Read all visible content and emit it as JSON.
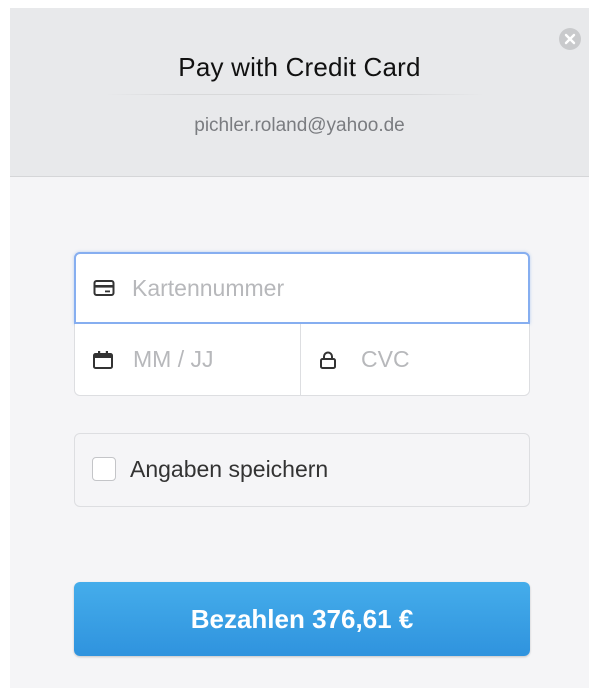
{
  "header": {
    "title": "Pay with Credit Card",
    "email": "pichler.roland@yahoo.de"
  },
  "form": {
    "card_number": {
      "placeholder": "Kartennummer",
      "value": "",
      "icon": "credit-card-icon"
    },
    "expiry": {
      "placeholder": "MM / JJ",
      "value": "",
      "icon": "calendar-icon"
    },
    "cvc": {
      "placeholder": "CVC",
      "value": "",
      "icon": "lock-icon"
    },
    "remember": {
      "label": "Angaben speichern",
      "checked": false
    }
  },
  "pay_button": {
    "label": "Bezahlen 376,61 €"
  },
  "colors": {
    "accent": "#3a9fe4",
    "focus_border": "#86aef0",
    "header_bg": "#e8e9eb"
  }
}
